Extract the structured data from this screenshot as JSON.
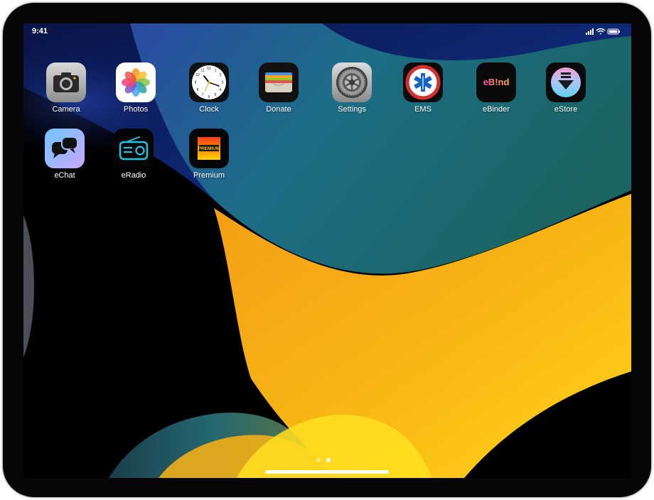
{
  "statusbar": {
    "time": "9:41",
    "icons": [
      "cellular-signal-icon",
      "wifi-icon",
      "battery-icon"
    ]
  },
  "apps": [
    {
      "id": "camera",
      "label": "Camera",
      "icon": "camera-icon"
    },
    {
      "id": "photos",
      "label": "Photos",
      "icon": "photos-flower-icon"
    },
    {
      "id": "clock",
      "label": "Clock",
      "icon": "clock-icon"
    },
    {
      "id": "donate",
      "label": "Donate",
      "icon": "wallet-cards-icon"
    },
    {
      "id": "settings",
      "label": "Settings",
      "icon": "gear-icon"
    },
    {
      "id": "ems",
      "label": "EMS",
      "icon": "star-of-life-icon",
      "badge_text": "EMERGENCY MEDICAL SERVICES"
    },
    {
      "id": "ebinder",
      "label": "eBinder",
      "icon": "ebinder-logo-icon",
      "logo_text": "eB!nd"
    },
    {
      "id": "estore",
      "label": "eStore",
      "icon": "download-arrow-icon"
    },
    {
      "id": "echat",
      "label": "eChat",
      "icon": "chat-bubbles-icon"
    },
    {
      "id": "eradio",
      "label": "eRadio",
      "icon": "radio-icon"
    },
    {
      "id": "premium",
      "label": "Premium",
      "icon": "premium-icon",
      "logo_text": "PREMIUM"
    }
  ],
  "page_indicator": {
    "pages": 2,
    "current": 2
  },
  "colors": {
    "wallpaper_navy": "#0c1a5a",
    "wallpaper_teal": "#1f6f7a",
    "wallpaper_yellow": "#f6b411",
    "estore_blue": "#33a6e6",
    "eradio_cyan": "#1ec4e0",
    "ebinder_pink": "#ff5ab4"
  }
}
